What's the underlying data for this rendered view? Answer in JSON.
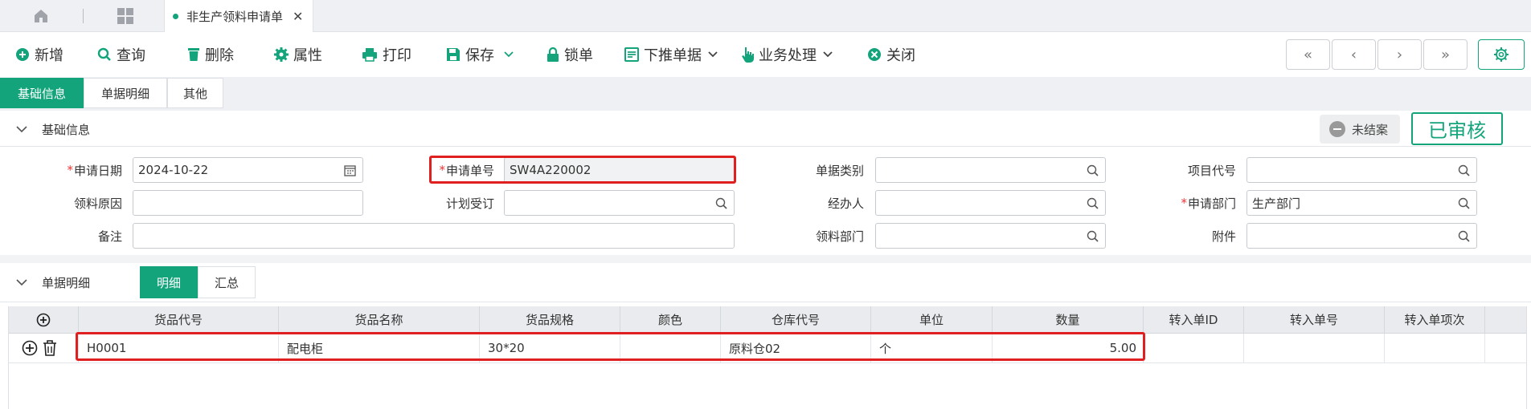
{
  "tabs": {
    "home_icon": "home-icon",
    "apps_icon": "grid-icon",
    "active_tab": "非生产领料申请单",
    "close": "✕"
  },
  "toolbar": {
    "new": "新增",
    "query": "查询",
    "delete": "删除",
    "properties": "属性",
    "print": "打印",
    "save": "保存",
    "lock": "锁单",
    "push_down": "下推单据",
    "business": "业务处理",
    "close": "关闭"
  },
  "nav": {
    "first": "«",
    "prev": "‹",
    "next": "›",
    "last": "»"
  },
  "page_tabs": [
    "基础信息",
    "单据明细",
    "其他"
  ],
  "basic_section": {
    "title": "基础信息",
    "status": "未结案",
    "audit_stamp": "已审核"
  },
  "form": {
    "apply_date": {
      "label": "申请日期",
      "value": "2024-10-22",
      "required": true
    },
    "apply_no": {
      "label": "申请单号",
      "value": "SW4A220002",
      "required": true
    },
    "doc_type": {
      "label": "单据类别",
      "value": ""
    },
    "project_code": {
      "label": "项目代号",
      "value": ""
    },
    "reason": {
      "label": "领料原因",
      "value": ""
    },
    "plan_order": {
      "label": "计划受订",
      "value": ""
    },
    "handler": {
      "label": "经办人",
      "value": ""
    },
    "apply_dept": {
      "label": "申请部门",
      "value": "生产部门",
      "required": true
    },
    "remark": {
      "label": "备注",
      "value": ""
    },
    "pick_dept": {
      "label": "领料部门",
      "value": ""
    },
    "attachment": {
      "label": "附件",
      "value": ""
    }
  },
  "detail_section": {
    "title": "单据明细",
    "tabs": [
      "明细",
      "汇总"
    ]
  },
  "table": {
    "columns": [
      "货品代号",
      "货品名称",
      "货品规格",
      "颜色",
      "仓库代号",
      "单位",
      "数量",
      "转入单ID",
      "转入单号",
      "转入单项次"
    ],
    "rows": [
      {
        "code": "H0001",
        "name": "配电柜",
        "spec": "30*20",
        "color": "",
        "warehouse": "原料仓02",
        "unit": "个",
        "qty": "5.00",
        "in_id": "",
        "in_no": "",
        "in_item": ""
      }
    ]
  },
  "colors": {
    "accent": "#14a47c",
    "highlight": "#e02020"
  }
}
